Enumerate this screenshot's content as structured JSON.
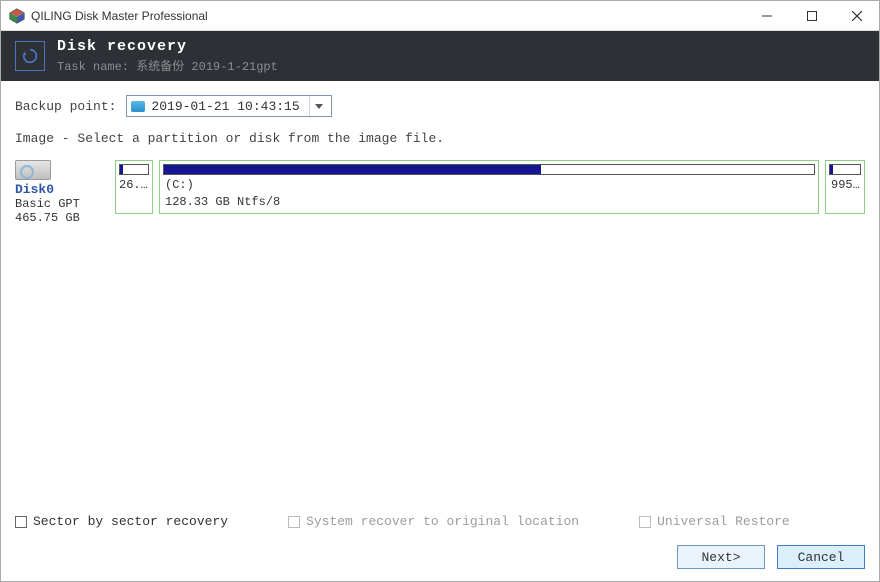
{
  "window": {
    "title": "QILING Disk Master Professional"
  },
  "header": {
    "title": "Disk recovery",
    "subtitle_label": "Task name:",
    "subtitle_value": "系统备份 2019-1-21gpt"
  },
  "backup_point": {
    "label": "Backup point:",
    "selected": "2019-01-21 10:43:15"
  },
  "instruction": "Image - Select a partition or disk from the image file.",
  "disk": {
    "name": "Disk0",
    "type": "Basic GPT",
    "size": "465.75 GB",
    "partitions": [
      {
        "label": "",
        "info": "26...",
        "usage_pct": 12
      },
      {
        "label": "(C:)",
        "info": "128.33 GB Ntfs/8",
        "usage_pct": 58
      },
      {
        "label": "",
        "info": "995...",
        "usage_pct": 10
      }
    ]
  },
  "options": {
    "sector": "Sector by sector recovery",
    "system_recover": "System recover to original location",
    "universal_restore": "Universal Restore"
  },
  "buttons": {
    "next": "Next>",
    "cancel": "Cancel"
  }
}
